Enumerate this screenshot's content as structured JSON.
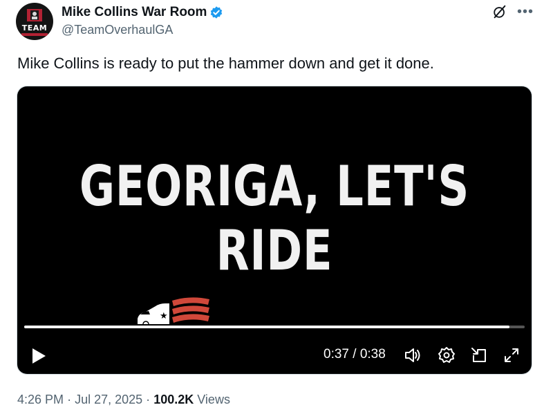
{
  "author": {
    "display_name": "Mike Collins War Room",
    "handle": "@TeamOverhaulGA",
    "avatar_text": "TEAM",
    "verified_icon": "verified-badge-icon",
    "verified_color": "#1d9bf0"
  },
  "tweet": {
    "text": "Mike Collins is ready to put the hammer down and get it done."
  },
  "video": {
    "title": "GEORIGA, LET'S RIDE",
    "current_time": "0:37",
    "separator": "/",
    "duration": "0:38",
    "progress_fraction": 0.97,
    "controls": [
      "play-icon",
      "volume-icon",
      "settings-icon",
      "pip-icon",
      "fullscreen-icon"
    ]
  },
  "meta": {
    "time": "4:26 PM",
    "dot1": "·",
    "date": "Jul 27, 2025",
    "dot2": "·",
    "views_count": "100.2K",
    "views_label": "Views"
  },
  "colors": {
    "text_primary": "#0f1419",
    "text_secondary": "#536471",
    "accent_blue": "#1d9bf0",
    "flag_red": "#d0483a"
  }
}
